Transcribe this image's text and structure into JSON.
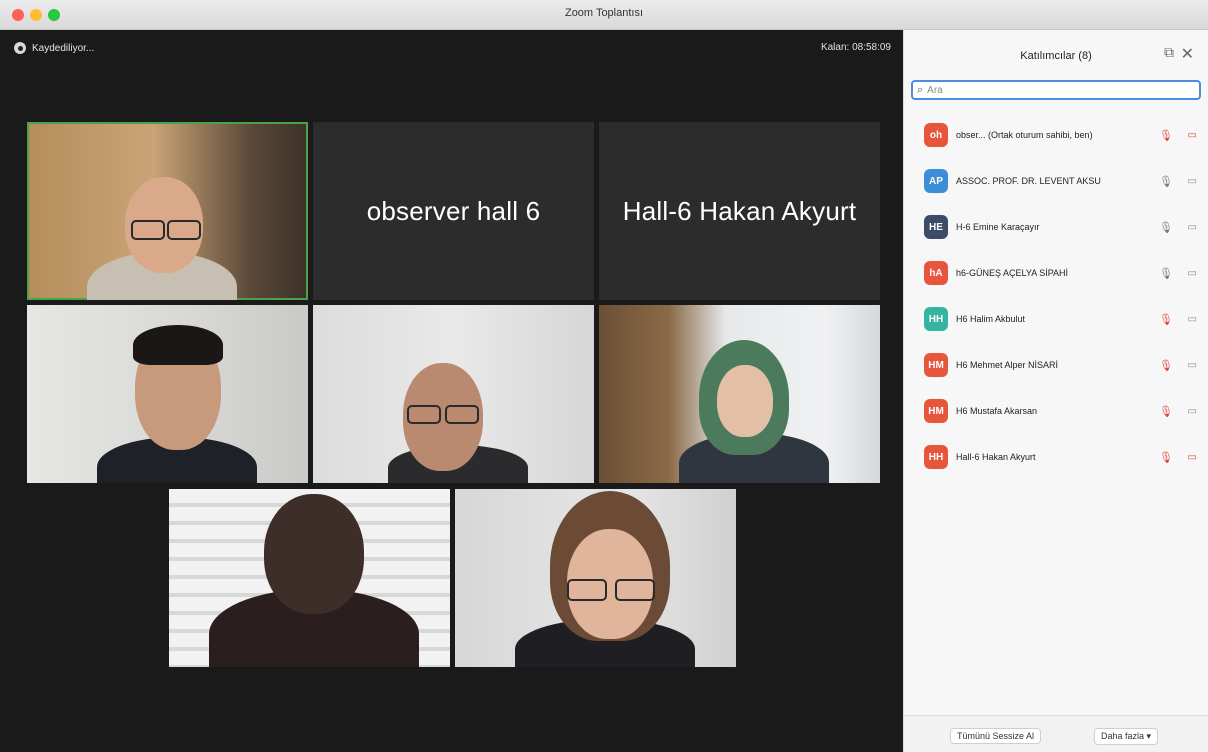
{
  "window": {
    "title": "Zoom Toplantısı"
  },
  "meeting": {
    "recording_label": "Kaydediliyor...",
    "time_left": "Kalan: 08:58:09",
    "name_tiles": [
      {
        "label": "observer hall 6"
      },
      {
        "label": "Hall-6 Hakan Akyurt"
      }
    ]
  },
  "participants_panel": {
    "title": "Katılımcılar (8)",
    "search_placeholder": "Ara",
    "participants": [
      {
        "initials": "oh",
        "name": "obser... (Ortak oturum sahibi, ben)",
        "avatar_color": "#e8553d",
        "mic": "off",
        "video": "off"
      },
      {
        "initials": "AP",
        "name": "ASSOC. PROF. DR. LEVENT AKSU",
        "avatar_color": "#3b8fd6",
        "mic": "on",
        "video": "on"
      },
      {
        "initials": "HE",
        "name": "H-6 Emine Karaçayır",
        "avatar_color": "#3c4b66",
        "mic": "on",
        "video": "on"
      },
      {
        "initials": "hA",
        "name": "h6-GÜNEŞ AÇELYA SİPAHİ",
        "avatar_color": "#e8553d",
        "mic": "on",
        "video": "on"
      },
      {
        "initials": "HH",
        "name": "H6 Halim Akbulut",
        "avatar_color": "#36b3a1",
        "mic": "off",
        "video": "on"
      },
      {
        "initials": "HM",
        "name": "H6 Mehmet Alper NİSARİ",
        "avatar_color": "#e8553d",
        "mic": "off",
        "video": "on"
      },
      {
        "initials": "HM",
        "name": "H6 Mustafa Akarsan",
        "avatar_color": "#e8553d",
        "mic": "off",
        "video": "on"
      },
      {
        "initials": "HH",
        "name": "Hall-6 Hakan Akyurt",
        "avatar_color": "#e8553d",
        "mic": "off",
        "video": "off"
      }
    ],
    "mute_all_label": "Tümünü Sessize Al",
    "more_label": "Daha fazla ▾"
  },
  "colors": {
    "active_speaker_border": "#4aa34a",
    "search_focus": "#4c8fe0",
    "muted_red": "#e0433a"
  }
}
